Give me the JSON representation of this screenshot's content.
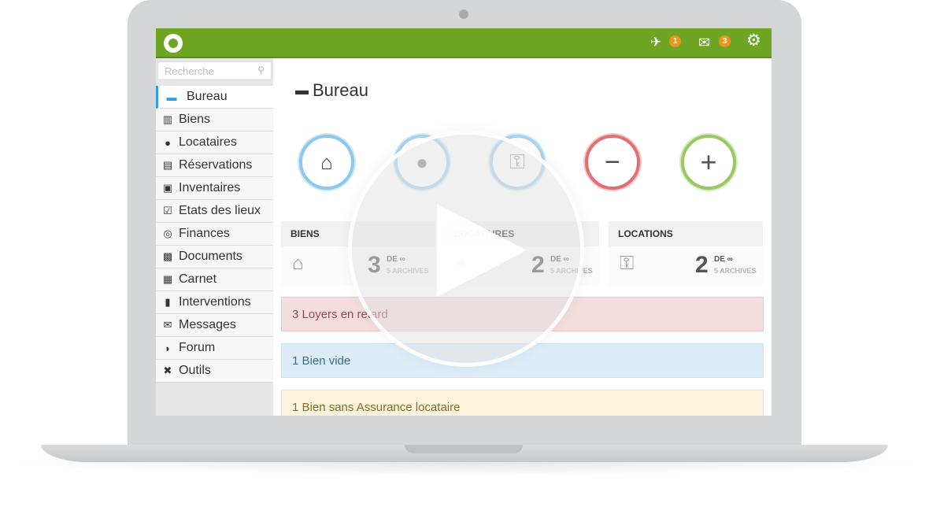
{
  "header": {
    "logo": "a",
    "pin_icon": "pin-icon",
    "pin_badge": "1",
    "mail_icon": "mail-icon",
    "mail_badge": "3",
    "settings_icon": "gear-icon"
  },
  "sidebar": {
    "search_placeholder": "Recherche",
    "items": [
      {
        "label": "Bureau",
        "icon": "monitor-icon"
      },
      {
        "label": "Biens",
        "icon": "door-icon"
      },
      {
        "label": "Locataires",
        "icon": "users-icon"
      },
      {
        "label": "Réservations",
        "icon": "notebook-icon"
      },
      {
        "label": "Inventaires",
        "icon": "armchair-icon"
      },
      {
        "label": "Etats des lieux",
        "icon": "checklist-icon"
      },
      {
        "label": "Finances",
        "icon": "coins-icon"
      },
      {
        "label": "Documents",
        "icon": "briefcase-icon"
      },
      {
        "label": "Carnet",
        "icon": "address-book-icon"
      },
      {
        "label": "Interventions",
        "icon": "paint-roller-icon"
      },
      {
        "label": "Messages",
        "icon": "envelope-icon"
      },
      {
        "label": "Forum",
        "icon": "chat-icon"
      },
      {
        "label": "Outils",
        "icon": "tools-icon"
      }
    ]
  },
  "main": {
    "title": "Bureau",
    "cards": [
      {
        "title": "BIENS",
        "count": "3",
        "de": "DE ∞",
        "archives": "5 ARCHIVES"
      },
      {
        "title": "LOCATAIRES",
        "count": "2",
        "de": "DE ∞",
        "archives": "5 ARCHIVES"
      },
      {
        "title": "LOCATIONS",
        "count": "2",
        "de": "DE ∞",
        "archives": "5 ARCHIVES"
      }
    ],
    "alerts": [
      {
        "text": "3 Loyers en retard",
        "color": "#f3dddd"
      },
      {
        "text": "1 Bien vide",
        "color": "#dcedf8"
      },
      {
        "text": "1 Bien sans Assurance locataire",
        "color": "#fbf4dc"
      }
    ]
  },
  "colors": {
    "brand_green": "#6ea623",
    "active_blue": "#2aa1e4",
    "badge_orange": "#f2921f"
  }
}
